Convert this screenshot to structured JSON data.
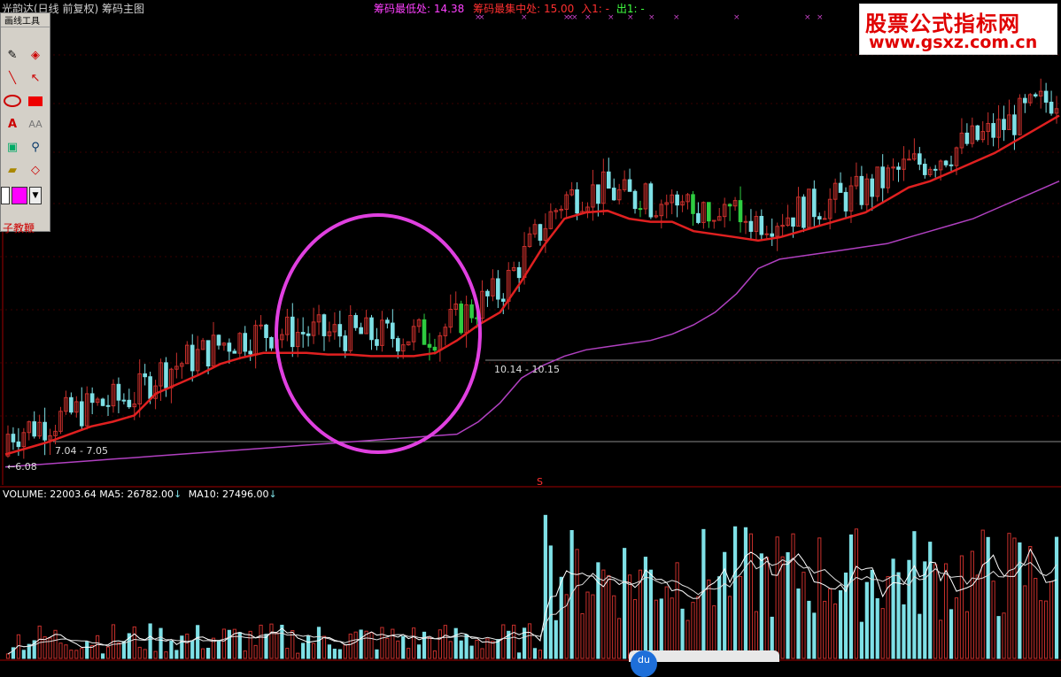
{
  "header": {
    "title": "光韵达(日线 前复权) 筹码主图",
    "low_label": "筹码最低处:",
    "low_value": "14.38",
    "center_label": "筹码最集中处:",
    "center_value": "15.00",
    "in_label": "入1:",
    "in_value": "-",
    "out_label": "出1:",
    "out_value": "-"
  },
  "colors": {
    "background": "#000000",
    "up_candle": "#c8302c",
    "down_candle": "#7ee0e6",
    "chip_green": "#2ecc40",
    "ma_red": "#e02020",
    "ma_purple": "#b040c0",
    "circle": "#e040e0",
    "header_pink": "#ff40ff",
    "header_red": "#ff3030",
    "header_green": "#40ff40"
  },
  "toolbox": {
    "title": "画线工具",
    "tools": [
      "pen-icon",
      "eraser-icon",
      "line-icon",
      "arrow-icon",
      "ellipse-icon",
      "rectangle-icon",
      "text-icon",
      "text-outline-icon",
      "screen-icon",
      "zoom-icon",
      "folder-icon",
      "diamond-icon"
    ],
    "bottom_label": "子教鞭"
  },
  "watermark": {
    "line1": "股票公式指标网",
    "line2": "www.gsxz.com.cn"
  },
  "price_tags": {
    "low": "6.08",
    "range1": "7.04 - 7.05",
    "range2": "10.14 - 10.15"
  },
  "volume_header": {
    "volume_label": "VOLUME:",
    "volume_value": "22003.64",
    "ma5_label": "MA5:",
    "ma5_value": "26782.00",
    "ma10_label": "MA10:",
    "ma10_value": "27496.00"
  },
  "chart_data": [
    {
      "type": "candlestick",
      "title": "",
      "price_range": [
        5.6,
        19.2
      ],
      "series": [
        {
          "name": "red-ma",
          "values": [
            6.35,
            6.55,
            6.75,
            7.0,
            7.25,
            7.4,
            7.6,
            8.3,
            8.6,
            8.9,
            9.25,
            9.45,
            9.6,
            9.6,
            9.6,
            9.55,
            9.55,
            9.5,
            9.5,
            9.5,
            9.6,
            10.0,
            10.5,
            10.9,
            11.9,
            13.0,
            13.9,
            14.1,
            14.15,
            13.9,
            13.8,
            13.8,
            13.5,
            13.4,
            13.3,
            13.2,
            13.3,
            13.5,
            13.7,
            13.9,
            14.1,
            14.5,
            14.9,
            15.1,
            15.4,
            15.7,
            16.0,
            16.4,
            16.8,
            17.2
          ]
        },
        {
          "name": "purple-ma",
          "values": [
            5.95,
            6.0,
            6.05,
            6.1,
            6.15,
            6.2,
            6.25,
            6.3,
            6.35,
            6.4,
            6.45,
            6.5,
            6.55,
            6.6,
            6.65,
            6.7,
            6.75,
            6.8,
            6.85,
            6.9,
            6.95,
            7.0,
            7.4,
            8.0,
            8.8,
            9.2,
            9.5,
            9.7,
            9.8,
            9.9,
            10.0,
            10.2,
            10.5,
            10.9,
            11.5,
            12.3,
            12.6,
            12.7,
            12.8,
            12.9,
            13.0,
            13.1,
            13.3,
            13.5,
            13.7,
            13.9,
            14.2,
            14.5,
            14.8,
            15.1
          ]
        }
      ],
      "annotations": [
        "6.08",
        "7.04 - 7.05",
        "10.14 - 10.15"
      ]
    },
    {
      "type": "bar",
      "title": "",
      "series": [
        {
          "name": "VOLUME",
          "value": 22003.64
        },
        {
          "name": "MA5",
          "value": 26782.0
        },
        {
          "name": "MA10",
          "value": 27496.0
        }
      ]
    }
  ]
}
